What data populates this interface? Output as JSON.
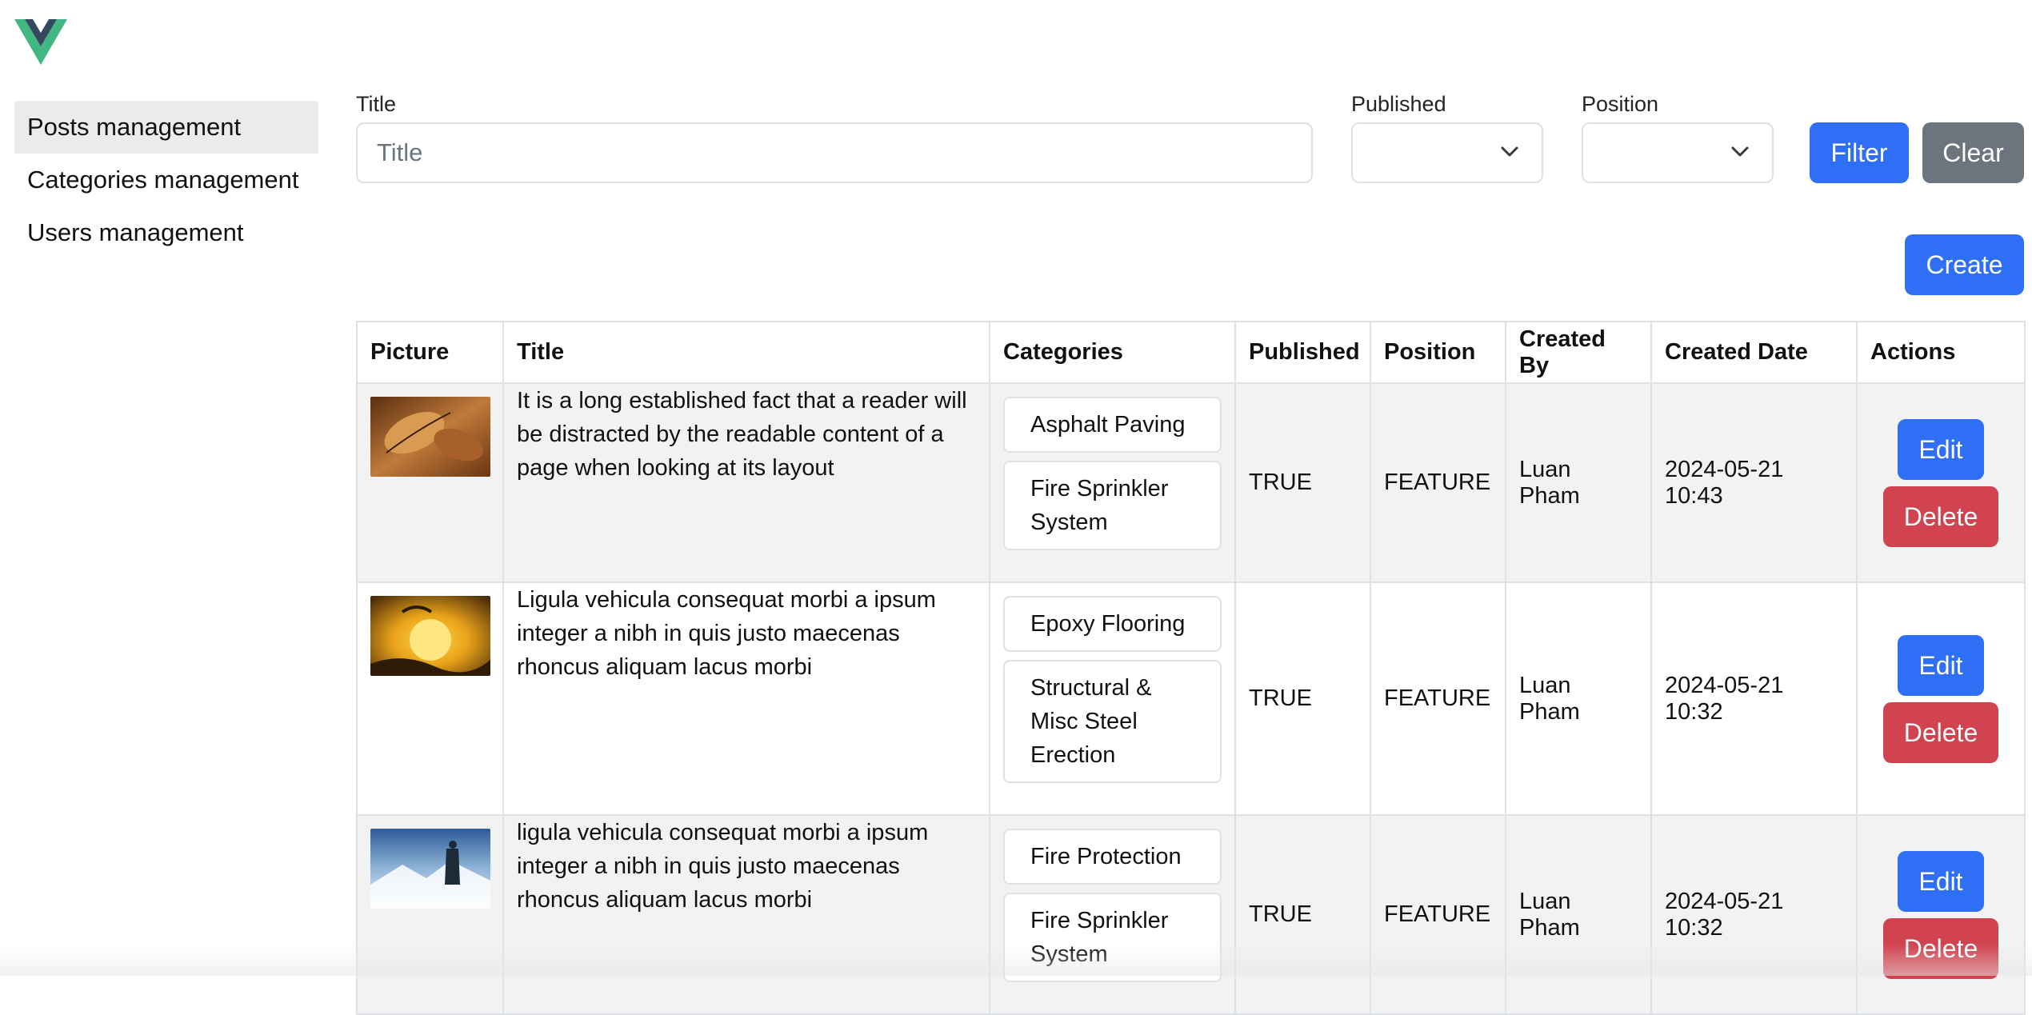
{
  "sidebar": {
    "items": [
      {
        "label": "Posts management",
        "active": true
      },
      {
        "label": "Categories management",
        "active": false
      },
      {
        "label": "Users management",
        "active": false
      }
    ]
  },
  "filters": {
    "title_label": "Title",
    "title_placeholder": "Title",
    "title_value": "",
    "published_label": "Published",
    "published_value": "",
    "position_label": "Position",
    "position_value": "",
    "filter_button": "Filter",
    "clear_button": "Clear"
  },
  "create_button": "Create",
  "table": {
    "headers": [
      "Picture",
      "Title",
      "Categories",
      "Published",
      "Position",
      "Created By",
      "Created Date",
      "Actions"
    ],
    "rows": [
      {
        "picture": "autumn-leaves-photo",
        "title": "It is a long established fact that a reader will be distracted by the readable content of a page when looking at its layout",
        "categories": [
          "Asphalt Paving",
          "Fire Sprinkler System"
        ],
        "published": "TRUE",
        "position": "FEATURE",
        "created_by": "Luan Pham",
        "created_date": "2024-05-21 10:43",
        "edit": "Edit",
        "delete": "Delete"
      },
      {
        "picture": "paragliding-sunset-photo",
        "title": "Ligula vehicula consequat morbi a ipsum integer a nibh in quis justo maecenas rhoncus aliquam lacus morbi",
        "categories": [
          "Epoxy Flooring",
          "Structural & Misc Steel Erection"
        ],
        "published": "TRUE",
        "position": "FEATURE",
        "created_by": "Luan Pham",
        "created_date": "2024-05-21 10:32",
        "edit": "Edit",
        "delete": "Delete"
      },
      {
        "picture": "mountain-hiker-photo",
        "title": "ligula vehicula consequat morbi a ipsum integer a nibh in quis justo maecenas rhoncus aliquam lacus morbi",
        "categories": [
          "Fire Protection",
          "Fire Sprinkler System"
        ],
        "published": "TRUE",
        "position": "FEATURE",
        "created_by": "Luan Pham",
        "created_date": "2024-05-21 10:32",
        "edit": "Edit",
        "delete": "Delete"
      }
    ]
  },
  "colors": {
    "primary": "#2f6ff5",
    "secondary": "#6c757d",
    "danger": "#d0434f",
    "logo_green": "#41b883",
    "logo_dark": "#34495e"
  }
}
